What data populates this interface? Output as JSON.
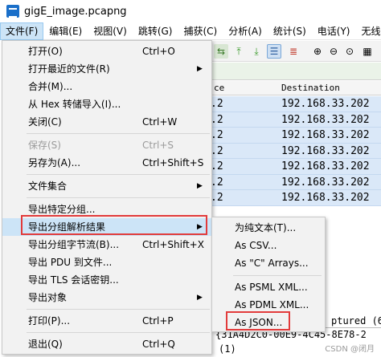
{
  "window": {
    "title": "gigE_image.pcapng"
  },
  "menubar": [
    "文件(F)",
    "编辑(E)",
    "视图(V)",
    "跳转(G)",
    "捕获(C)",
    "分析(A)",
    "统计(S)",
    "电话(Y)",
    "无线("
  ],
  "packet_list": {
    "columns": {
      "source_fragment": "ce",
      "destination": "Destination"
    },
    "rows": [
      {
        "source_tail": ".2",
        "destination": "192.168.33.202"
      },
      {
        "source_tail": ".2",
        "destination": "192.168.33.202"
      },
      {
        "source_tail": ".2",
        "destination": "192.168.33.202"
      },
      {
        "source_tail": ".2",
        "destination": "192.168.33.202"
      },
      {
        "source_tail": ".2",
        "destination": "192.168.33.202"
      },
      {
        "source_tail": ".2",
        "destination": "192.168.33.202"
      },
      {
        "source_tail": ".2",
        "destination": "192.168.33.202"
      }
    ]
  },
  "details": {
    "line1": "ptured (6",
    "line2": "{31A4D2C0-00E9-4C45-8E78-2",
    "line3": "(1)"
  },
  "watermark": "CSDN @闭月",
  "file_menu": {
    "items": [
      {
        "label": "打开(O)",
        "shortcut": "Ctrl+O"
      },
      {
        "label": "打开最近的文件(R)",
        "arrow": "▶"
      },
      {
        "label": "合并(M)..."
      },
      {
        "label": "从 Hex 转储导入(I)..."
      },
      {
        "label": "关闭(C)",
        "shortcut": "Ctrl+W"
      },
      {
        "label": "保存(S)",
        "shortcut": "Ctrl+S"
      },
      {
        "label": "另存为(A)...",
        "shortcut": "Ctrl+Shift+S"
      },
      {
        "label": "文件集合",
        "arrow": "▶"
      },
      {
        "label": "导出特定分组..."
      },
      {
        "label": "导出分组解析结果",
        "arrow": "▶"
      },
      {
        "label": "导出分组字节流(B)...",
        "shortcut": "Ctrl+Shift+X"
      },
      {
        "label": "导出 PDU 到文件..."
      },
      {
        "label": "导出 TLS 会话密钥..."
      },
      {
        "label": "导出对象",
        "arrow": "▶"
      },
      {
        "label": "打印(P)...",
        "shortcut": "Ctrl+P"
      },
      {
        "label": "退出(Q)",
        "shortcut": "Ctrl+Q"
      }
    ]
  },
  "export_submenu": {
    "items": [
      {
        "label": "为纯文本(T)..."
      },
      {
        "label": "As CSV..."
      },
      {
        "label": "As \"C\" Arrays..."
      },
      {
        "label": "As PSML XML..."
      },
      {
        "label": "As PDML XML..."
      },
      {
        "label": "As JSON..."
      }
    ]
  },
  "colors": {
    "highlight": "#cce4f7",
    "annotation_red": "#e23b3b",
    "packet_row": "#dae8f8"
  }
}
